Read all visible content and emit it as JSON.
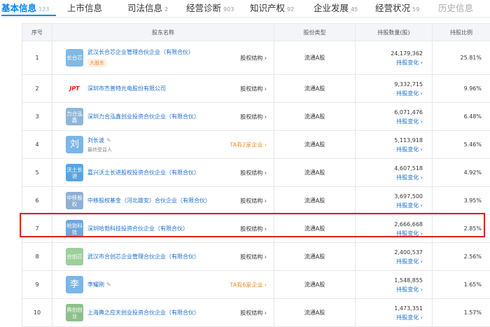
{
  "tabs": [
    {
      "label": "基本信息",
      "count": "123",
      "active": true
    },
    {
      "label": "上市信息",
      "count": "",
      "active": false
    },
    {
      "label": "司法信息",
      "count": "2",
      "active": false
    },
    {
      "label": "经营诊断",
      "count": "903",
      "active": false
    },
    {
      "label": "知识产权",
      "count": "92",
      "active": false
    },
    {
      "label": "企业发展",
      "count": "45",
      "active": false
    },
    {
      "label": "经营状况",
      "count": "59",
      "active": false
    },
    {
      "label": "历史信息",
      "count": "",
      "active": false
    }
  ],
  "table": {
    "headers": {
      "index": "序号",
      "name": "股东名称",
      "type": "股份类型",
      "quantity": "持股数量(股)",
      "ratio": "持股比例"
    },
    "equity_label": "股权结构",
    "change_label": "持股变化",
    "rows": [
      {
        "index": "1",
        "logo": "长合芯",
        "logo_color": "#7fb9e6",
        "name": "武汉长合芯企业管理合伙企业（有限合伙）",
        "tag": "大股东",
        "note": "",
        "ta": "",
        "type": "流通A股",
        "quantity": "24,179,362",
        "ratio": "25.81%"
      },
      {
        "index": "2",
        "logo": "JPT",
        "logo_color": "#ffffff",
        "name": "深圳市杰普特光电股份有限公司",
        "tag": "",
        "note": "",
        "ta": "",
        "type": "流通A股",
        "quantity": "9,332,715",
        "ratio": "9.96%"
      },
      {
        "index": "3",
        "logo": "力合泓鑫",
        "logo_color": "#8fb6d9",
        "name": "深圳力合泓鑫创业投资合伙企业（有限合伙）",
        "tag": "",
        "note": "",
        "ta": "",
        "type": "流通A股",
        "quantity": "6,071,476",
        "ratio": "6.48%"
      },
      {
        "index": "4",
        "logo": "刘",
        "logo_color": "#7ab6e8",
        "name": "刘长波",
        "tag": "",
        "note": "最终受益人",
        "ta": "TA有2家企业",
        "type": "流通A股",
        "quantity": "5,113,918",
        "ratio": "5.46%"
      },
      {
        "index": "5",
        "logo": "沃土长进",
        "logo_color": "#5aa5e0",
        "name": "嘉兴沃土长进股权投资合伙企业（有限合伙）",
        "tag": "",
        "note": "",
        "ta": "",
        "type": "流通A股",
        "quantity": "4,607,518",
        "ratio": "4.92%"
      },
      {
        "index": "6",
        "logo": "中移股权",
        "logo_color": "#8fb0d6",
        "name": "中移股权基金（河北雄安）合伙企业（有限合伙）",
        "tag": "",
        "note": "",
        "ta": "",
        "type": "流通A股",
        "quantity": "3,697,500",
        "ratio": "3.95%"
      },
      {
        "index": "7",
        "logo": "哈勃科技",
        "logo_color": "#6fa7dc",
        "name": "深圳哈勃科技投资合伙企业（有限合伙）",
        "tag": "",
        "note": "",
        "ta": "",
        "type": "流通A股",
        "quantity": "2,666,668",
        "ratio": "2.85%"
      },
      {
        "index": "8",
        "logo": "合创芯",
        "logo_color": "#9ccf9c",
        "name": "武汉市合创芯企业管理合伙企业（有限合伙）",
        "tag": "",
        "note": "",
        "ta": "",
        "type": "流通A股",
        "quantity": "2,400,537",
        "ratio": "2.56%"
      },
      {
        "index": "9",
        "logo": "李",
        "logo_color": "#7ab6e8",
        "name": "李耀刚",
        "tag": "",
        "note": "",
        "ta": "TA有6家企业",
        "type": "流通A股",
        "quantity": "1,548,855",
        "ratio": "1.65%"
      },
      {
        "index": "10",
        "logo": "典创创业",
        "logo_color": "#8cc08c",
        "name": "上海典之应天创业投资合伙企业（有限合伙）",
        "tag": "",
        "note": "",
        "ta": "",
        "type": "流通A股",
        "quantity": "1,473,351",
        "ratio": "1.57%"
      }
    ]
  }
}
